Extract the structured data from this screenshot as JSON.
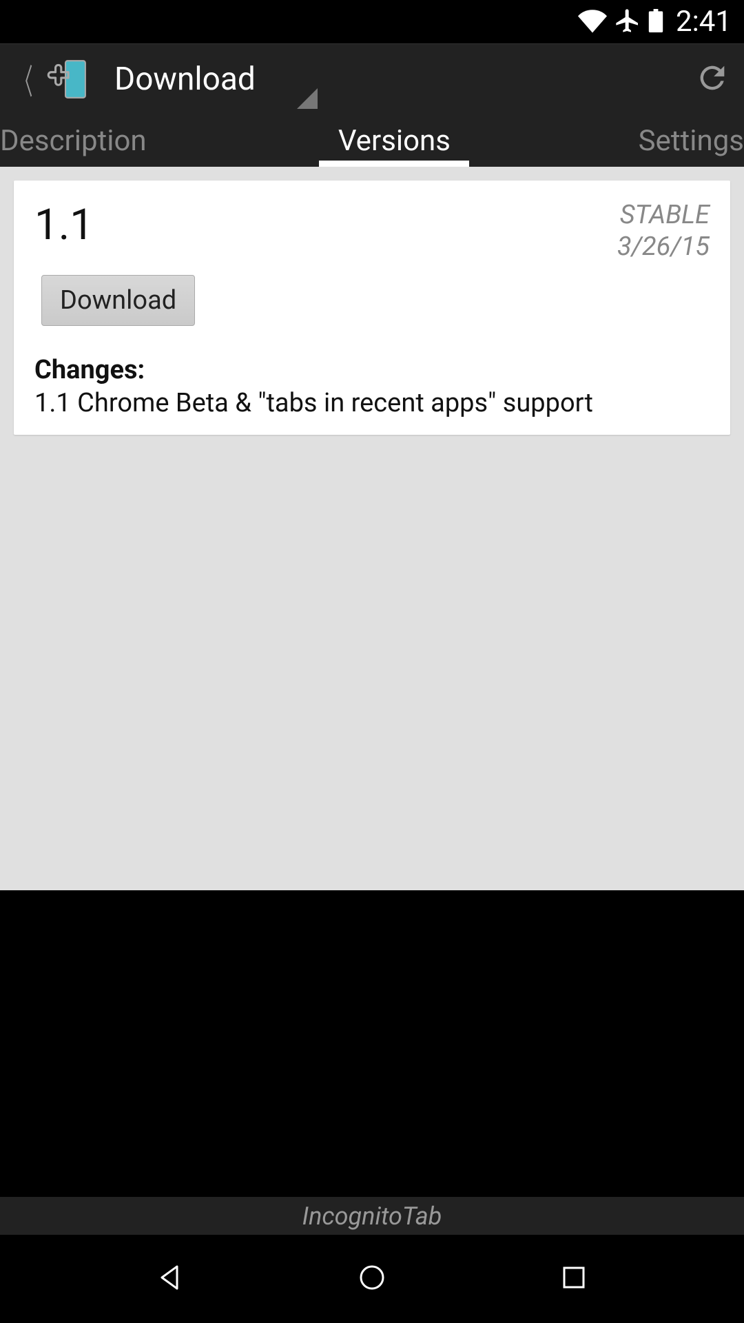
{
  "status": {
    "time": "2:41"
  },
  "actionbar": {
    "title": "Download"
  },
  "tabs": {
    "items": [
      "Description",
      "Versions",
      "Settings"
    ],
    "active": 1
  },
  "version": {
    "number": "1.1",
    "channel": "STABLE",
    "date": "3/26/15",
    "download_label": "Download",
    "changes_label": "Changes:",
    "changes_text": "1.1 Chrome Beta & \"tabs in recent apps\" support"
  },
  "footer": {
    "app_name": "IncognitoTab"
  }
}
